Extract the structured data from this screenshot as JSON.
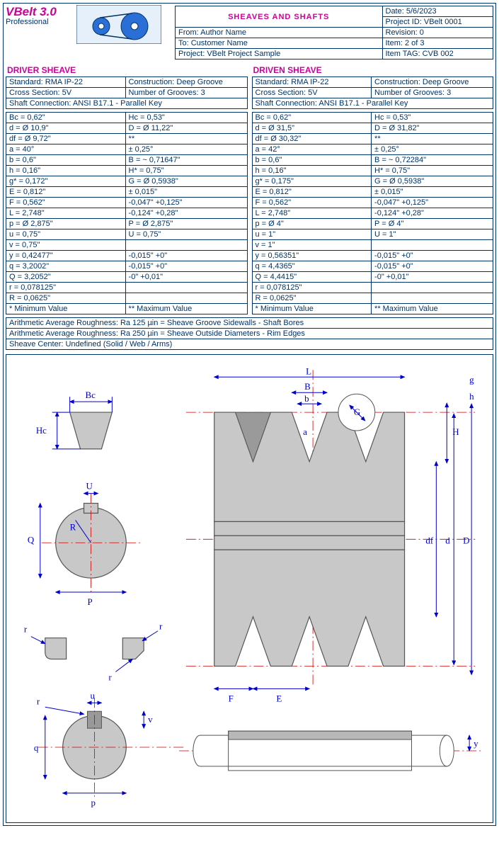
{
  "app": {
    "name": "VBelt 3.0",
    "edition": "Professional"
  },
  "title": "SHEAVES AND SHAFTS",
  "meta": {
    "date": "Date:  5/6/2023",
    "project_id": "Project ID:  VBelt 0001",
    "from": "From:  Author Name",
    "revision": "Revision:  0",
    "to": "To:  Customer Name",
    "item": "Item:  2 of 3",
    "project": "Project:  VBelt Project Sample",
    "tag": "Item TAG:  CVB 002"
  },
  "driver": {
    "heading": "DRIVER SHEAVE",
    "standard": "Standard:  RMA IP-22",
    "construction": "Construction:  Deep Groove",
    "cross_section": "Cross Section:  5V",
    "grooves": "Number of Grooves:  3",
    "shaft_conn": "Shaft Connection:  ANSI B17.1 - Parallel Key",
    "rows": [
      [
        "Bc  =  0,62\"",
        "Hc  =  0,53\""
      ],
      [
        "d  =  Ø 10,9\"",
        "D  =  Ø 11,22\""
      ],
      [
        "df  =  Ø 9,72\"",
        "**"
      ],
      [
        "a  =  40°",
        "± 0,25°"
      ],
      [
        "b  =  0,6\"",
        "B  =  ~ 0,71647\""
      ],
      [
        "h  =  0,16\"",
        "H*  =  0,75\""
      ],
      [
        "g*  =  0,172\"",
        "G  =  Ø 0,5938\""
      ],
      [
        "E  =  0,812\"",
        "± 0,015\""
      ],
      [
        "F  =  0,562\"",
        "-0,047\"   +0,125\""
      ],
      [
        "L  =  2,748\"",
        "-0,124\"   +0,28\""
      ],
      [
        "p  =  Ø 2,875\"",
        "P  =  Ø 2,875\""
      ],
      [
        "u  =  0,75\"",
        "U  =  0,75\""
      ],
      [
        "v  =  0,75\"",
        ""
      ],
      [
        "y  =  0,42477\"",
        "-0,015\"   +0\""
      ],
      [
        "q  =  3,2002\"",
        "-0,015\"   +0\""
      ],
      [
        "Q  =  3,2052\"",
        "-0\"   +0,01\""
      ],
      [
        "r  =  0,078125\"",
        ""
      ],
      [
        "R  =  0,0625\"",
        ""
      ],
      [
        "* Minimum Value",
        "** Maximum Value"
      ]
    ]
  },
  "driven": {
    "heading": "DRIVEN SHEAVE",
    "standard": "Standard:  RMA IP-22",
    "construction": "Construction:  Deep Groove",
    "cross_section": "Cross Section:  5V",
    "grooves": "Number of Grooves:  3",
    "shaft_conn": "Shaft Connection:  ANSI B17.1 - Parallel Key",
    "rows": [
      [
        "Bc  =  0,62\"",
        "Hc  =  0,53\""
      ],
      [
        "d  =  Ø 31,5\"",
        "D  =  Ø 31,82\""
      ],
      [
        "df  =  Ø 30,32\"",
        "**"
      ],
      [
        "a  =  42°",
        "± 0,25°"
      ],
      [
        "b  =  0,6\"",
        "B  =  ~ 0,72284\""
      ],
      [
        "h  =  0,16\"",
        "H*  =  0,75\""
      ],
      [
        "g*  =  0,175\"",
        "G  =  Ø 0,5938\""
      ],
      [
        "E  =  0,812\"",
        "± 0,015\""
      ],
      [
        "F  =  0,562\"",
        "-0,047\"   +0,125\""
      ],
      [
        "L  =  2,748\"",
        "-0,124\"   +0,28\""
      ],
      [
        "p  =  Ø 4\"",
        "P  =  Ø 4\""
      ],
      [
        "u  =  1\"",
        "U  =  1\""
      ],
      [
        "v  =  1\"",
        ""
      ],
      [
        "y  =  0,56351\"",
        "-0,015\"   +0\""
      ],
      [
        "q  =  4,4365\"",
        "-0,015\"   +0\""
      ],
      [
        "Q  =  4,4415\"",
        "-0\"   +0,01\""
      ],
      [
        "r  =  0,078125\"",
        ""
      ],
      [
        "R  =  0,0625\"",
        ""
      ],
      [
        "* Minimum Value",
        "** Maximum Value"
      ]
    ]
  },
  "notes": {
    "n1": "Arithmetic Average Roughness:  Ra 125 µin  =  Sheave Groove Sidewalls - Shaft Bores",
    "n2": "Arithmetic Average Roughness:  Ra 250 µin  =  Sheave Outside Diameters - Rim Edges",
    "n3": "Sheave Center:  Undefined (Solid / Web / Arms)"
  },
  "diagram_labels": {
    "Bc": "Bc",
    "Hc": "Hc",
    "U": "U",
    "R": "R",
    "Q": "Q",
    "P": "P",
    "r": "r",
    "u": "u",
    "v": "v",
    "q": "q",
    "p": "p",
    "L": "L",
    "B": "B",
    "b": "b",
    "a": "a",
    "G": "G",
    "F": "F",
    "E": "E",
    "H": "H",
    "g": "g",
    "h": "h",
    "df": "df",
    "d": "d",
    "D": "D",
    "y": "y"
  }
}
